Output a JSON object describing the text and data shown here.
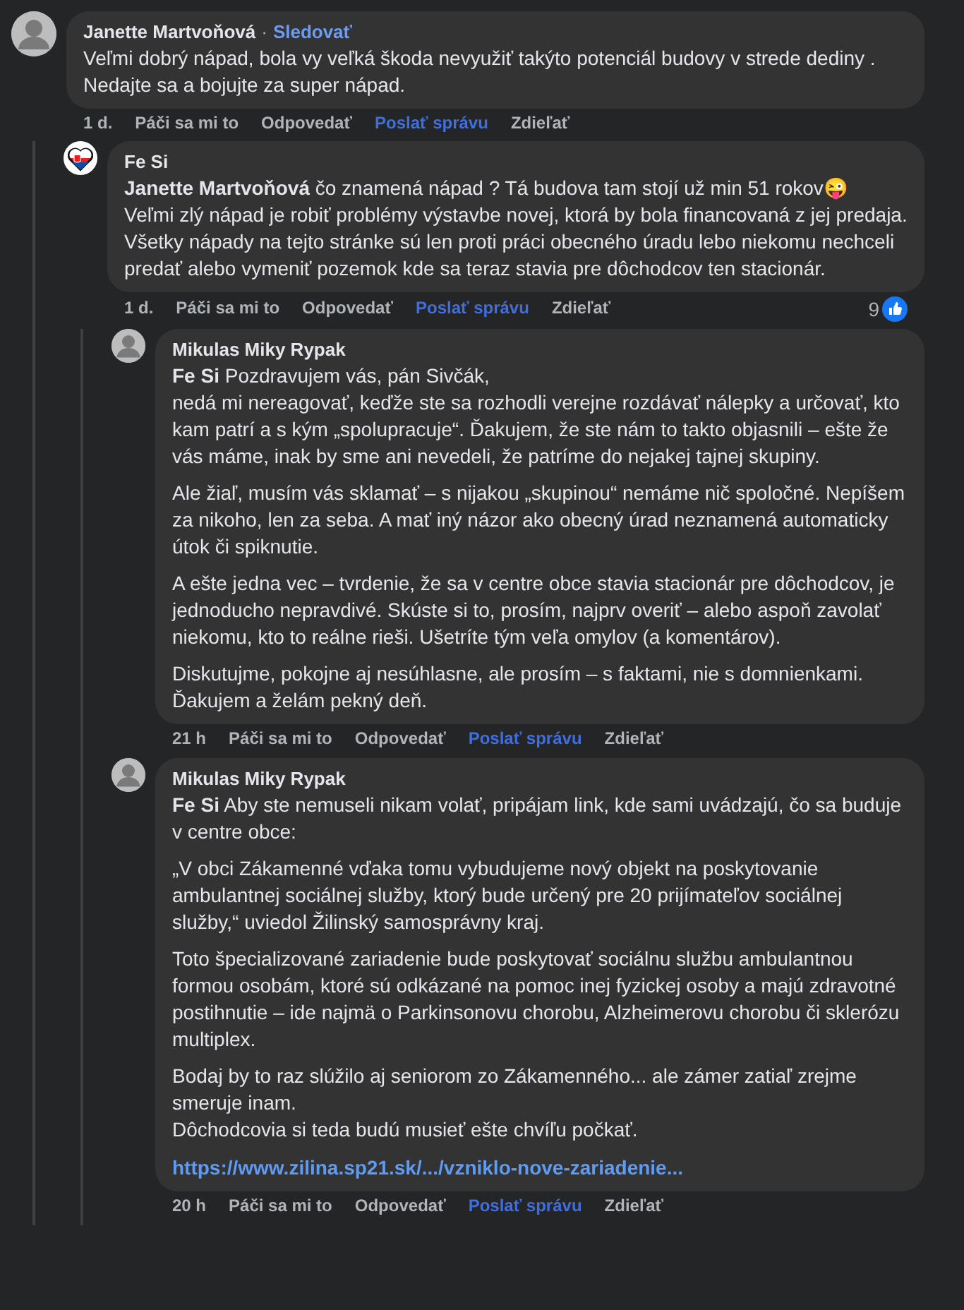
{
  "comments": [
    {
      "author": "Janette Martvoňová",
      "separator": "·",
      "follow": "Sledovať",
      "kind": "photo",
      "paragraphs": [
        "Veľmi dobrý nápad, bola vy veľká škoda nevyužiť takýto potenciál budovy v strede dediny .\nNedajte sa a bojujte za super nápad."
      ],
      "time": "1 d.",
      "actions": [
        {
          "label": "Páči sa mi to",
          "kind": "plain"
        },
        {
          "label": "Odpovedať",
          "kind": "plain"
        },
        {
          "label": "Poslať správu",
          "kind": "message"
        },
        {
          "label": "Zdieľať",
          "kind": "plain"
        }
      ],
      "children": [
        {
          "author": "Fe Si",
          "kind": "flag-heart",
          "paragraphs": [
            "**Janette Martvoňová** čo znamená nápad ? Tá budova tam stojí už min 51 rokov😜\nVeľmi zlý nápad je robiť problémy výstavbe novej, ktorá by bola financovaná z jej predaja.\nVšetky nápady na tejto stránke sú len proti práci obecného úradu lebo niekomu nechceli predať alebo vymeniť pozemok kde sa teraz stavia pre dôchodcov ten stacionár."
          ],
          "time": "1 d.",
          "actions": [
            {
              "label": "Páči sa mi to",
              "kind": "plain"
            },
            {
              "label": "Odpovedať",
              "kind": "plain"
            },
            {
              "label": "Poslať správu",
              "kind": "message"
            },
            {
              "label": "Zdieľať",
              "kind": "plain"
            }
          ],
          "reactions": "9",
          "children": [
            {
              "author": "Mikulas Miky Rypak",
              "kind": "photo",
              "paragraphs": [
                "**Fe Si** Pozdravujem vás, pán Sivčák,\nnedá mi nereagovať, keďže ste sa rozhodli verejne rozdávať nálepky a určovať, kto kam patrí a s kým „spolupracuje“. Ďakujem, že ste nám to takto objasnili – ešte že vás máme, inak by sme ani nevedeli, že patríme do nejakej tajnej skupiny.",
                "Ale žiaľ, musím vás sklamať – s nijakou „skupinou“ nemáme nič spoločné. Nepíšem za nikoho, len za seba. A mať iný názor ako obecný úrad neznamená automaticky útok či spiknutie.",
                "A ešte jedna vec – tvrdenie, že sa v centre obce stavia stacionár pre dôchodcov, je jednoducho nepravdivé. Skúste si to, prosím, najprv overiť – alebo aspoň zavolať niekomu, kto to reálne rieši. Ušetríte tým veľa omylov (a komentárov).",
                "Diskutujme, pokojne aj nesúhlasne, ale prosím – s faktami, nie s domnienkami. Ďakujem a želám pekný deň."
              ],
              "time": "21 h",
              "actions": [
                {
                  "label": "Páči sa mi to",
                  "kind": "plain"
                },
                {
                  "label": "Odpovedať",
                  "kind": "plain"
                },
                {
                  "label": "Poslať správu",
                  "kind": "message"
                },
                {
                  "label": "Zdieľať",
                  "kind": "plain"
                }
              ]
            },
            {
              "author": "Mikulas Miky Rypak",
              "kind": "photo",
              "paragraphs": [
                "**Fe Si** Aby ste nemuseli nikam volať, pripájam link, kde sami uvádzajú, čo sa buduje v centre obce:",
                "„V obci Zákamenné vďaka tomu vybudujeme nový objekt na poskytovanie ambulantnej sociálnej služby, ktorý bude určený pre 20 prijímateľov sociálnej služby,“ uviedol Žilinský samosprávny kraj.",
                "Toto špecializované zariadenie bude poskytovať sociálnu službu ambulantnou formou osobám, ktoré sú odkázané na pomoc inej fyzickej osoby a majú zdravotné postihnutie – ide najmä o Parkinsonovu chorobu, Alzheimerovu chorobu či sklerózu multiplex.",
                "Bodaj by to raz slúžilo aj seniorom zo Zákamenného... ale zámer zatiaľ zrejme smeruje inam.\nDôchodcovia si teda budú musieť ešte chvíľu počkať."
              ],
              "link": "https://www.zilina.sp21.sk/.../vzniklo-nove-zariadenie...",
              "time": "20 h",
              "actions": [
                {
                  "label": "Páči sa mi to",
                  "kind": "plain"
                },
                {
                  "label": "Odpovedať",
                  "kind": "plain"
                },
                {
                  "label": "Poslať správu",
                  "kind": "message"
                },
                {
                  "label": "Zdieľať",
                  "kind": "plain"
                }
              ]
            }
          ]
        }
      ]
    }
  ]
}
